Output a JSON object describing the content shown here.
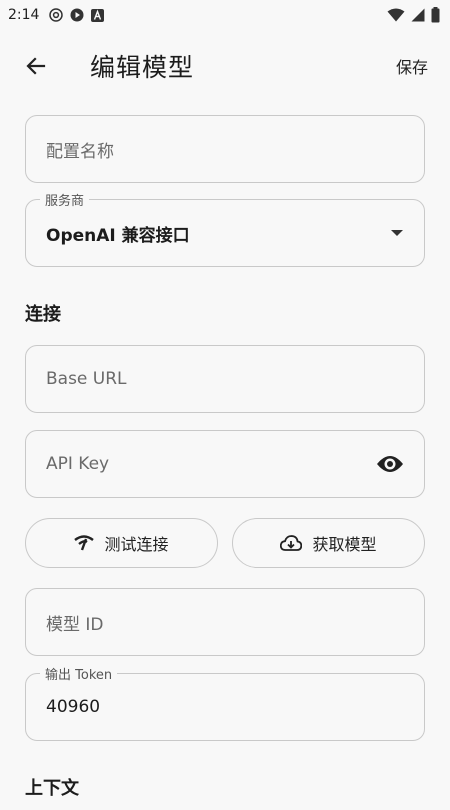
{
  "status_bar": {
    "time": "2:14"
  },
  "app_bar": {
    "title": "编辑模型",
    "save_label": "保存"
  },
  "form": {
    "config_name": {
      "placeholder": "配置名称"
    },
    "provider": {
      "label": "服务商",
      "value": "OpenAI 兼容接口"
    },
    "connection_section": {
      "title": "连接"
    },
    "base_url": {
      "placeholder": "Base URL"
    },
    "api_key": {
      "placeholder": "API Key"
    },
    "test_connection_label": "测试连接",
    "fetch_models_label": "获取模型",
    "model_id": {
      "placeholder": "模型 ID"
    },
    "output_token": {
      "label": "输出 Token",
      "value": "40960"
    },
    "context_section": {
      "title": "上下文"
    }
  },
  "colors": {
    "background": "#f8f8f8",
    "outline": "#c9c9c9",
    "text": "#1c1c1c"
  }
}
